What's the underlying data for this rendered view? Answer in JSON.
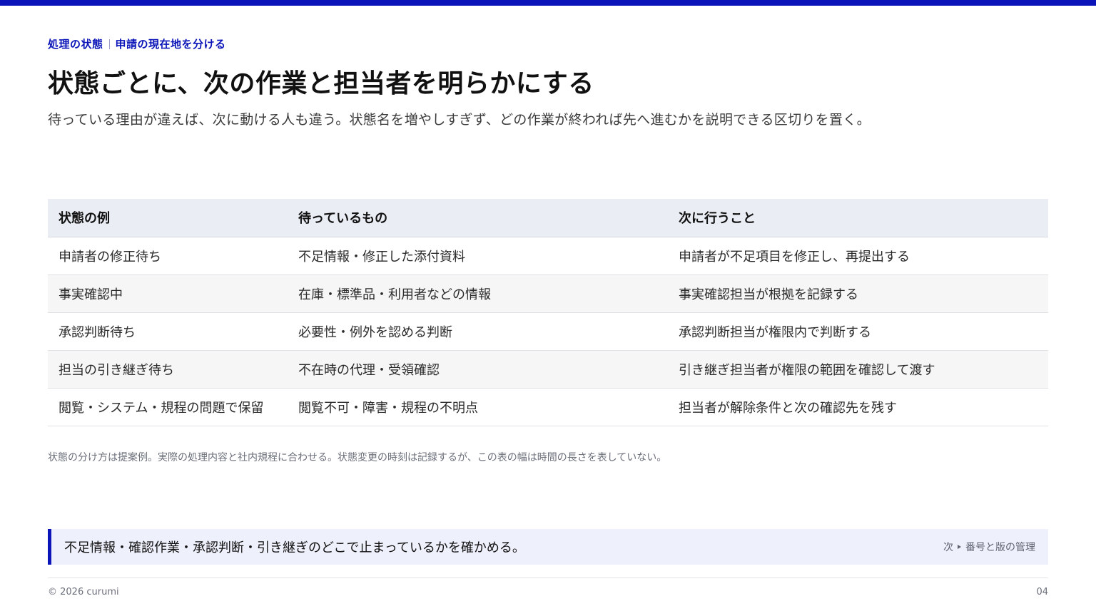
{
  "colors": {
    "accent": "#0a14b8",
    "callout_bg": "#eef0fb",
    "header_bg": "#eaedf3"
  },
  "header": {
    "kicker_section": "処理の状態",
    "kicker_topic": "申請の現在地を分ける",
    "title": "状態ごとに、次の作業と担当者を明らかにする",
    "subtitle": "待っている理由が違えば、次に動ける人も違う。状態名を増やしすぎず、どの作業が終われば先へ進むかを説明できる区切りを置く。"
  },
  "table": {
    "columns": [
      "状態の例",
      "待っているもの",
      "次に行うこと"
    ],
    "rows": [
      [
        "申請者の修正待ち",
        "不足情報・修正した添付資料",
        "申請者が不足項目を修正し、再提出する"
      ],
      [
        "事実確認中",
        "在庫・標準品・利用者などの情報",
        "事実確認担当が根拠を記録する"
      ],
      [
        "承認判断待ち",
        "必要性・例外を認める判断",
        "承認判断担当が権限内で判断する"
      ],
      [
        "担当の引き継ぎ待ち",
        "不在時の代理・受領確認",
        "引き継ぎ担当者が権限の範囲を確認して渡す"
      ],
      [
        "閲覧・システム・規程の問題で保留",
        "閲覧不可・障害・規程の不明点",
        "担当者が解除条件と次の確認先を残す"
      ]
    ]
  },
  "note": "状態の分け方は提案例。実際の処理内容と社内規程に合わせる。状態変更の時刻は記録するが、この表の幅は時間の長さを表していない。",
  "callout": {
    "text": "不足情報・確認作業・承認判断・引き継ぎのどこで止まっているかを確かめる。",
    "next_prefix": "次",
    "next_label": "番号と版の管理"
  },
  "footer": {
    "copyright": "© 2026 curumi",
    "page_number": "04"
  }
}
